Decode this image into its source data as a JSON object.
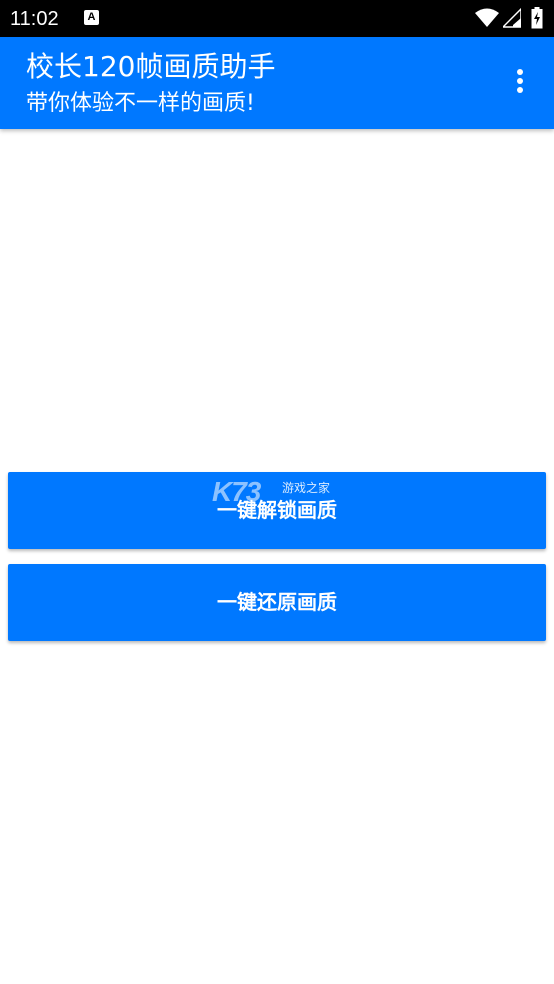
{
  "status_bar": {
    "time": "11:02",
    "notification_glyph": "A",
    "icons": [
      "notification-a-icon",
      "wifi-icon",
      "cell-signal-icon",
      "battery-charging-icon"
    ]
  },
  "app_bar": {
    "title": "校长120帧画质助手",
    "subtitle": "带你体验不一样的画质!",
    "menu_icon": "more-vert-icon",
    "color": "#0078ff"
  },
  "buttons": {
    "unlock_label": "一键解锁画质",
    "restore_label": "一键还原画质"
  },
  "watermark": {
    "logo": "K73",
    "text": "游戏之家"
  }
}
